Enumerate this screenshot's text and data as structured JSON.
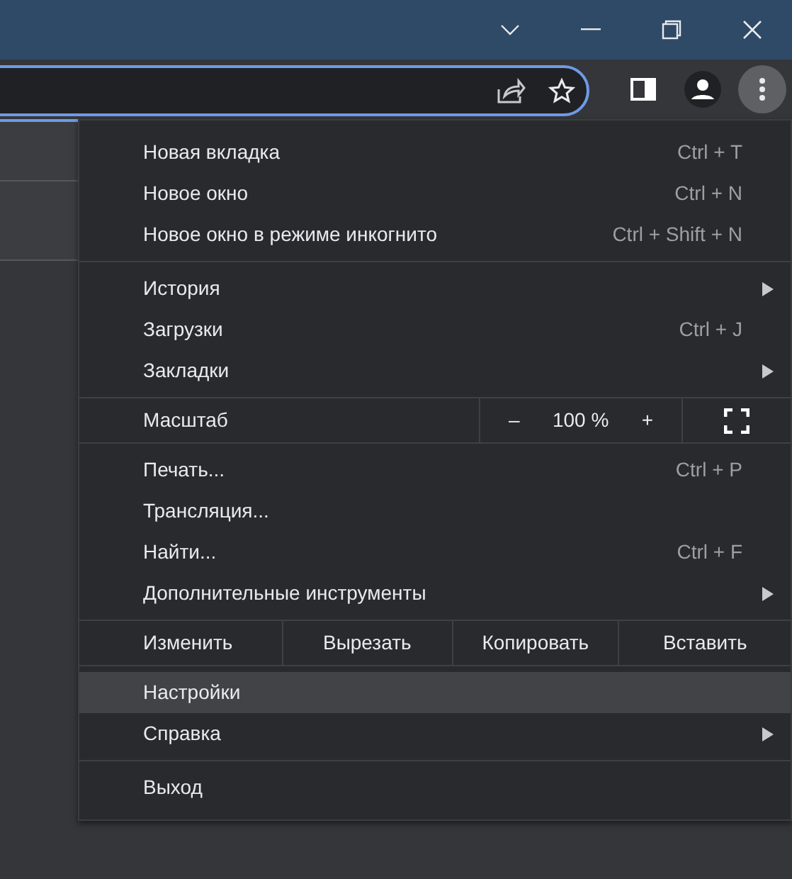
{
  "toolbar": {
    "menu_button": {
      "active": true
    }
  },
  "menu": {
    "sections": [
      {
        "items": [
          {
            "kind": "item",
            "label": "Новая вкладка",
            "shortcut": "Ctrl + T",
            "submenu": false,
            "selected": false
          },
          {
            "kind": "item",
            "label": "Новое окно",
            "shortcut": "Ctrl + N",
            "submenu": false,
            "selected": false
          },
          {
            "kind": "item",
            "label": "Новое окно в режиме инкогнито",
            "shortcut": "Ctrl + Shift + N",
            "submenu": false,
            "selected": false
          }
        ]
      },
      {
        "items": [
          {
            "kind": "item",
            "label": "История",
            "submenu": true,
            "selected": false
          },
          {
            "kind": "item",
            "label": "Загрузки",
            "shortcut": "Ctrl + J",
            "submenu": false,
            "selected": false
          },
          {
            "kind": "item",
            "label": "Закладки",
            "submenu": true,
            "selected": false
          }
        ]
      },
      {
        "items": [
          {
            "kind": "zoom",
            "label": "Масштаб",
            "minus": "–",
            "value": "100 %",
            "plus": "+"
          }
        ]
      },
      {
        "items": [
          {
            "kind": "item",
            "label": "Печать...",
            "shortcut": "Ctrl + P",
            "submenu": false,
            "selected": false
          },
          {
            "kind": "item",
            "label": "Трансляция...",
            "submenu": false,
            "selected": false
          },
          {
            "kind": "item",
            "label": "Найти...",
            "shortcut": "Ctrl + F",
            "submenu": false,
            "selected": false
          },
          {
            "kind": "item",
            "label": "Дополнительные инструменты",
            "submenu": true,
            "selected": false
          }
        ]
      },
      {
        "items": [
          {
            "kind": "edit",
            "label": "Изменить",
            "actions": [
              "Вырезать",
              "Копировать",
              "Вставить"
            ]
          }
        ]
      },
      {
        "items": [
          {
            "kind": "item",
            "label": "Настройки",
            "submenu": false,
            "selected": true
          },
          {
            "kind": "item",
            "label": "Справка",
            "submenu": true,
            "selected": false
          }
        ]
      },
      {
        "items": [
          {
            "kind": "item",
            "label": "Выход",
            "submenu": false,
            "selected": false
          }
        ]
      }
    ]
  }
}
